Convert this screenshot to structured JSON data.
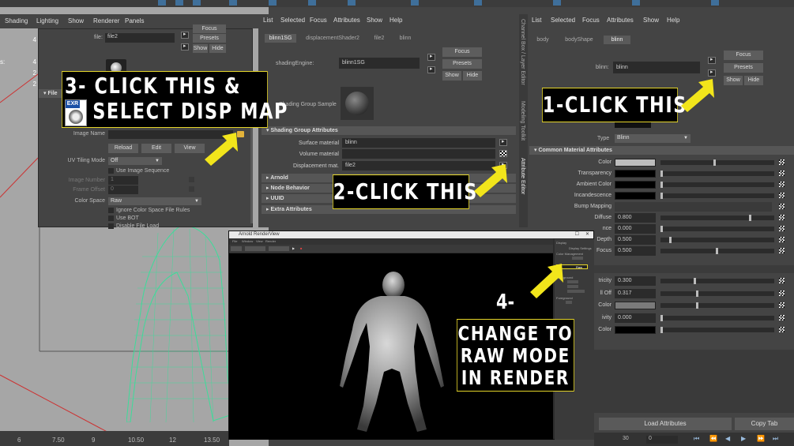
{
  "viewport": {
    "menus": [
      "Shading",
      "Lighting",
      "Show",
      "Renderer",
      "Panels"
    ],
    "hud": [
      {
        "label": "",
        "value": "4"
      },
      {
        "label": "s:",
        "value": "4"
      },
      {
        "label": "",
        "value": "2"
      },
      {
        "label": "",
        "value": "2"
      }
    ],
    "timeline": [
      "6",
      "7.50",
      "9",
      "10.50",
      "12",
      "13.50"
    ]
  },
  "file_panel": {
    "file_label": "file:",
    "file_value": "file2",
    "focus": "Focus",
    "presets": "Presets",
    "show": "Show",
    "hide": "Hide",
    "section_label": "File",
    "exr_badge": "EXR",
    "image_name_label": "Image Name",
    "reload": "Reload",
    "edit": "Edit",
    "view": "View",
    "uv_tiling_label": "UV Tiling Mode",
    "uv_tiling_value": "Off",
    "use_image_sequence": "Use Image Sequence",
    "image_number_label": "Image Number",
    "image_number_value": "1",
    "frame_offset_label": "Frame Offset",
    "frame_offset_value": "0",
    "color_space_label": "Color Space",
    "color_space_value": "Raw",
    "ignore_cs_rules": "Ignore Color Space File Rules",
    "use_bot": "Use BOT",
    "disable_file_load": "Disable File Load"
  },
  "mid_panel": {
    "menus": [
      "List",
      "Selected",
      "Focus",
      "Attributes",
      "Show",
      "Help"
    ],
    "tabs": [
      "blinn1SG",
      "displacementShader2",
      "file2",
      "blinn"
    ],
    "shading_engine_label": "shadingEngine:",
    "shading_engine_value": "blinn1SG",
    "focus": "Focus",
    "presets": "Presets",
    "show": "Show",
    "hide": "Hide",
    "sample_label": "Shading Group Sample",
    "section_sga": "Shading Group Attributes",
    "surface_label": "Surface material",
    "surface_value": "blinn",
    "volume_label": "Volume material",
    "volume_value": "",
    "displacement_label": "Displacement mat.",
    "displacement_value": "file2",
    "section_arnold": "Arnold",
    "section_node_behavior": "Node Behavior",
    "section_uuid": "UUID",
    "section_extra": "Extra Attributes",
    "vtabs": [
      "Channel Box / Layer Editor",
      "Modeling Toolkit",
      "Attribute Editor"
    ]
  },
  "right_panel": {
    "menus": [
      "List",
      "Selected",
      "Focus",
      "Attributes",
      "Show",
      "Help"
    ],
    "tabs": [
      "body",
      "bodyShape",
      "blinn"
    ],
    "node_label": "blinn:",
    "node_value": "blinn",
    "focus": "Focus",
    "presets": "Presets",
    "show": "Show",
    "hide": "Hide",
    "type_label": "Type",
    "type_value": "Blinn",
    "section_common": "Common Material Attributes",
    "attrs": [
      {
        "label": "Color",
        "kind": "swatch",
        "color": "#bdbdbd",
        "slider": 0.48
      },
      {
        "label": "Transparency",
        "kind": "swatch",
        "color": "#000000",
        "slider": 0.0
      },
      {
        "label": "Ambient Color",
        "kind": "swatch",
        "color": "#000000",
        "slider": 0.0
      },
      {
        "label": "Incandescence",
        "kind": "swatch",
        "color": "#000000",
        "slider": 0.0
      },
      {
        "label": "Bump Mapping",
        "kind": "field",
        "value": ""
      },
      {
        "label": "Diffuse",
        "kind": "number",
        "value": "0.800",
        "slider": 0.8
      },
      {
        "label": "nce",
        "kind": "number",
        "value": "0.000",
        "slider": 0.0
      },
      {
        "label": "Depth",
        "kind": "number",
        "value": "0.500",
        "slider": 0.08
      },
      {
        "label": "Focus",
        "kind": "number",
        "value": "0.500",
        "slider": 0.5
      }
    ],
    "attrs2": [
      {
        "label": "tricity",
        "kind": "number",
        "value": "0.300",
        "slider": 0.3
      },
      {
        "label": "ll Off",
        "kind": "number",
        "value": "0.317",
        "slider": 0.32
      },
      {
        "label": "Color",
        "kind": "swatch",
        "color": "#7a7a7a",
        "slider": 0.32
      },
      {
        "label": "ivity",
        "kind": "number",
        "value": "0.000",
        "slider": 0.0
      },
      {
        "label": "Color",
        "kind": "swatch",
        "color": "#000000",
        "slider": 0.0
      }
    ],
    "load_attributes": "Load Attributes",
    "copy_tab": "Copy Tab",
    "bottom_nums": [
      "30",
      "0"
    ]
  },
  "render_view": {
    "title": "Arnold RenderView",
    "menus": [
      "File",
      "Window",
      "View",
      "Render"
    ],
    "side_labels": [
      "Display",
      "Display Settings",
      "Color Management",
      "Raw",
      "Background",
      "Foreground"
    ]
  },
  "callouts": {
    "step1": "1-CLICK THIS",
    "step2": "2-CLICK THIS",
    "step3_line1": "3-   CLICK THIS &",
    "step3_line2": "SELECT DISP MAP",
    "step4_num": "4-",
    "step4_line1": "CHANGE TO",
    "step4_line2": "RAW MODE",
    "step4_line3": "IN RENDER"
  },
  "colors": {
    "callout_border": "#e6d62a",
    "arrow": "#f2e51b",
    "mesh": "#3ddc9a",
    "maya_bg": "#444444"
  }
}
